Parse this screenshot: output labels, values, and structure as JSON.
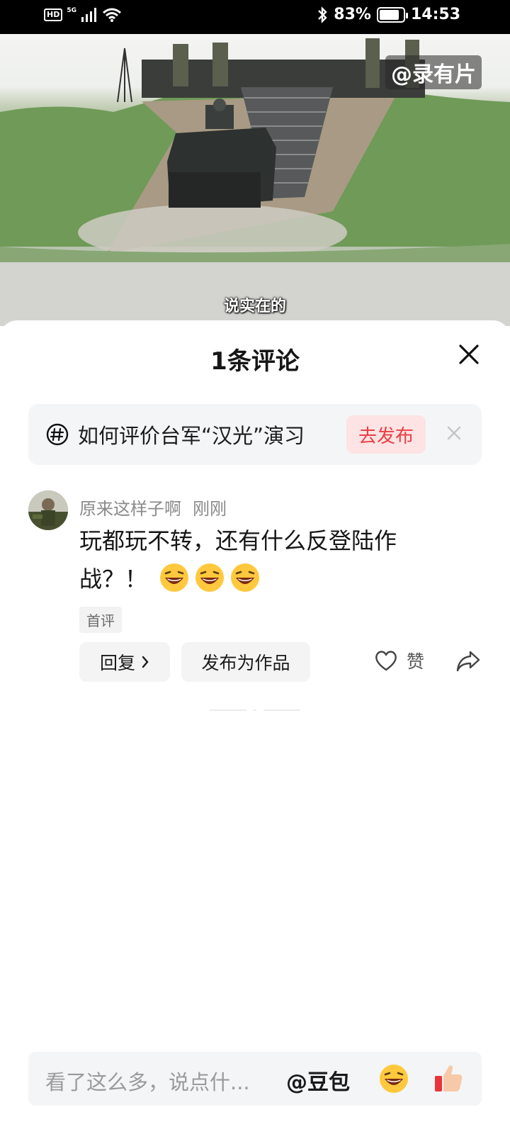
{
  "status_bar": {
    "hd": "HD",
    "network": "5G",
    "battery_percent": "83%",
    "battery_level": 0.83,
    "time": "14:53"
  },
  "video": {
    "watermark": "@录有片",
    "subtitle": "说实在的"
  },
  "comments_sheet": {
    "title": "1条评论",
    "topic": {
      "text": "如何评价台军“汉光”演习",
      "publish_label": "去发布"
    },
    "comments": [
      {
        "username": "原来这样子啊",
        "time": "刚刚",
        "text": "玩都玩不转，还有什么反登陆作战？！",
        "emojis": [
          "laughing-emoji",
          "laughing-emoji",
          "laughing-emoji"
        ],
        "badge": "首评",
        "reply_label": "回复",
        "publish_work_label": "发布为作品",
        "like_label": "赞"
      }
    ]
  },
  "input_bar": {
    "placeholder": "看了这么多，说点什...",
    "mention": "@豆包"
  },
  "colors": {
    "accent_red": "#ea3e46",
    "publish_bg": "#fde3e3"
  }
}
